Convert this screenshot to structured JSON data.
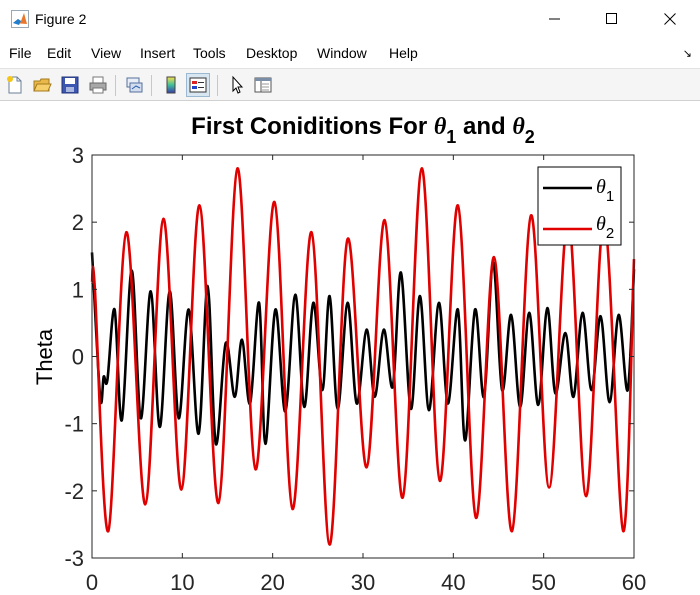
{
  "window": {
    "title": "Figure 2",
    "controls": [
      "minimize-icon",
      "maximize-icon",
      "close-icon"
    ]
  },
  "menu": {
    "items": [
      "File",
      "Edit",
      "View",
      "Insert",
      "Tools",
      "Desktop",
      "Window",
      "Help"
    ],
    "overflow_icon": "chevron-arrow-icon"
  },
  "toolbar": {
    "icons": [
      "new-figure-icon",
      "open-file-icon",
      "save-icon",
      "print-icon",
      "link-plot-icon",
      "insert-colorbar-icon",
      "insert-legend-icon",
      "edit-plot-pointer-icon",
      "property-inspector-icon"
    ],
    "active": "insert-legend-icon"
  },
  "colors": {
    "theta1": "#000000",
    "theta2": "#e00000",
    "titlebar": "#ffffff",
    "toolbar": "#f5f5f5"
  },
  "chart_data": {
    "type": "line",
    "title": "First Coniditions For θ1 and θ2",
    "title_parts": {
      "prefix": "First Coniditions For ",
      "sym1": "θ",
      "sub1": "1",
      "mid": " and ",
      "sym2": "θ",
      "sub2": "2"
    },
    "xlabel": "",
    "ylabel": "Theta",
    "xlim": [
      0,
      60
    ],
    "ylim": [
      -3,
      3
    ],
    "xticks": [
      0,
      10,
      20,
      30,
      40,
      50,
      60
    ],
    "yticks": [
      3,
      2,
      1,
      0,
      -1,
      -2,
      -3
    ],
    "grid": false,
    "legend": {
      "placement": "top-right",
      "entries": [
        {
          "symbol": "θ",
          "sub": "1"
        },
        {
          "symbol": "θ",
          "sub": "2"
        }
      ]
    },
    "series": [
      {
        "name": "θ1",
        "color": "#000000",
        "points": [
          [
            0,
            1.55
          ],
          [
            0.9,
            -0.6
          ],
          [
            1.3,
            -0.3
          ],
          [
            1.7,
            -0.35
          ],
          [
            2.5,
            0.7
          ],
          [
            3.3,
            -0.95
          ],
          [
            4.4,
            1.28
          ],
          [
            5.4,
            -0.92
          ],
          [
            6.5,
            0.97
          ],
          [
            7.5,
            -1.05
          ],
          [
            8.6,
            0.97
          ],
          [
            9.6,
            -0.92
          ],
          [
            10.7,
            0.7
          ],
          [
            11.8,
            -1.15
          ],
          [
            12.8,
            1.05
          ],
          [
            13.7,
            -1.3
          ],
          [
            14.8,
            0.2
          ],
          [
            15.8,
            -0.6
          ],
          [
            16.6,
            0.25
          ],
          [
            17.5,
            -0.7
          ],
          [
            18.5,
            0.8
          ],
          [
            19.2,
            -1.3
          ],
          [
            20.3,
            0.7
          ],
          [
            21.4,
            -0.82
          ],
          [
            22.5,
            0.92
          ],
          [
            23.5,
            -0.75
          ],
          [
            24.5,
            0.8
          ],
          [
            25.5,
            -0.5
          ],
          [
            26.3,
            0.9
          ],
          [
            27.2,
            -0.78
          ],
          [
            28.3,
            0.8
          ],
          [
            29.3,
            -0.7
          ],
          [
            30.4,
            0.4
          ],
          [
            31.3,
            -0.6
          ],
          [
            32.3,
            0.4
          ],
          [
            33.3,
            -0.45
          ],
          [
            34.2,
            1.25
          ],
          [
            35.3,
            -0.78
          ],
          [
            36.3,
            0.9
          ],
          [
            37.3,
            -0.8
          ],
          [
            38.4,
            0.8
          ],
          [
            39.4,
            -0.7
          ],
          [
            40.5,
            0.7
          ],
          [
            41.3,
            -1.25
          ],
          [
            42.4,
            0.7
          ],
          [
            43.4,
            -0.6
          ],
          [
            44.4,
            1.4
          ],
          [
            45.4,
            -0.5
          ],
          [
            46.4,
            0.62
          ],
          [
            47.4,
            -0.75
          ],
          [
            48.4,
            0.65
          ],
          [
            49.4,
            -0.72
          ],
          [
            50.4,
            0.72
          ],
          [
            51.3,
            -0.55
          ],
          [
            52.4,
            0.35
          ],
          [
            53.3,
            -0.6
          ],
          [
            54.3,
            0.65
          ],
          [
            55.3,
            -0.5
          ],
          [
            56.3,
            0.6
          ],
          [
            57.3,
            -0.68
          ],
          [
            58.3,
            0.62
          ],
          [
            59.3,
            -0.5
          ],
          [
            60,
            1.3
          ]
        ]
      },
      {
        "name": "θ2",
        "color": "#e00000",
        "points": [
          [
            0,
            1.1
          ],
          [
            0.3,
            1.05
          ],
          [
            1.8,
            -2.6
          ],
          [
            3.8,
            1.85
          ],
          [
            5.9,
            -2.2
          ],
          [
            7.9,
            2.05
          ],
          [
            9.9,
            -1.98
          ],
          [
            11.9,
            2.25
          ],
          [
            14,
            -2.18
          ],
          [
            16.1,
            2.8
          ],
          [
            18.1,
            -1.68
          ],
          [
            20.2,
            2.3
          ],
          [
            22.2,
            -2.27
          ],
          [
            24.3,
            1.85
          ],
          [
            26.3,
            -2.8
          ],
          [
            28.3,
            1.75
          ],
          [
            30.4,
            -1.65
          ],
          [
            32.4,
            2.03
          ],
          [
            34.4,
            -2.1
          ],
          [
            36.5,
            2.8
          ],
          [
            38.5,
            -1.85
          ],
          [
            40.5,
            2.25
          ],
          [
            42.5,
            -2.4
          ],
          [
            44.5,
            1.48
          ],
          [
            46.5,
            -2.6
          ],
          [
            48.6,
            2.1
          ],
          [
            50.6,
            -1.95
          ],
          [
            52.7,
            2.08
          ],
          [
            54.7,
            -2.08
          ],
          [
            56.7,
            2.05
          ],
          [
            58.8,
            -2.6
          ],
          [
            60,
            1.45
          ]
        ]
      }
    ]
  }
}
